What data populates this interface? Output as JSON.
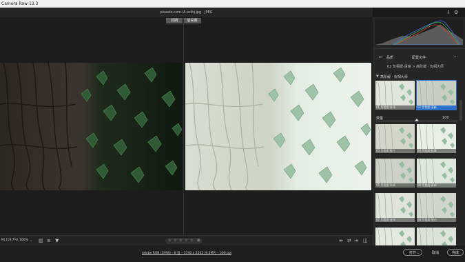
{
  "window": {
    "title": "Camera Raw 13.3"
  },
  "header": {
    "filename": "pixaolo.com-iA-wdhj.jpg  ·  JPEG"
  },
  "view_tabs": [
    {
      "label": "前期"
    },
    {
      "label": "后来期"
    }
  ],
  "sidebar": {
    "back_icon": "arrow-left-icon",
    "tab_presets": "品质",
    "tab_profiles": "配置文件",
    "more_icon": "ellipsis-icon",
    "breadcrumb": "02 负相缓-清晰  >  高阶缓 · 负相大师",
    "group_name": "高阶缓 · 负相大师",
    "amount_label": "数量",
    "amount_value": "100",
    "amount_fraction": 0.5,
    "presets": [
      {
        "label": "01 负相缓-灰绿"
      },
      {
        "label": "02 负相缓-清晰",
        "selected": true
      },
      {
        "label": "03 负相缓-胶片"
      },
      {
        "label": "04 负相缓-轻雾"
      },
      {
        "label": "05 负相缓-灰调"
      },
      {
        "label": "06 负相缓-青绿"
      },
      {
        "label": "07 负相缓-淡绿"
      },
      {
        "label": "08 负相缓-银白"
      },
      {
        "label": "09 负相缓-冷色"
      },
      {
        "label": "10 负相缓-暖白"
      }
    ]
  },
  "bottombar": {
    "fit_label": "Fit (19.7%)",
    "zoom_label": "100%",
    "rating_stars": "☆ ☆ ☆ ☆ ☆",
    "colors": {
      "accent": "#2f6fce",
      "histogram_red": "#d23a3a",
      "histogram_green": "#3ab24a",
      "histogram_blue": "#4a6ae0"
    }
  },
  "status": {
    "info_link": "Adobe RGB (1998) – 8 位 – 3740 x 2505 (9.3MP) – 300 ppi",
    "open_button": "打开",
    "cancel_button": "取消",
    "done_button": "完成"
  }
}
